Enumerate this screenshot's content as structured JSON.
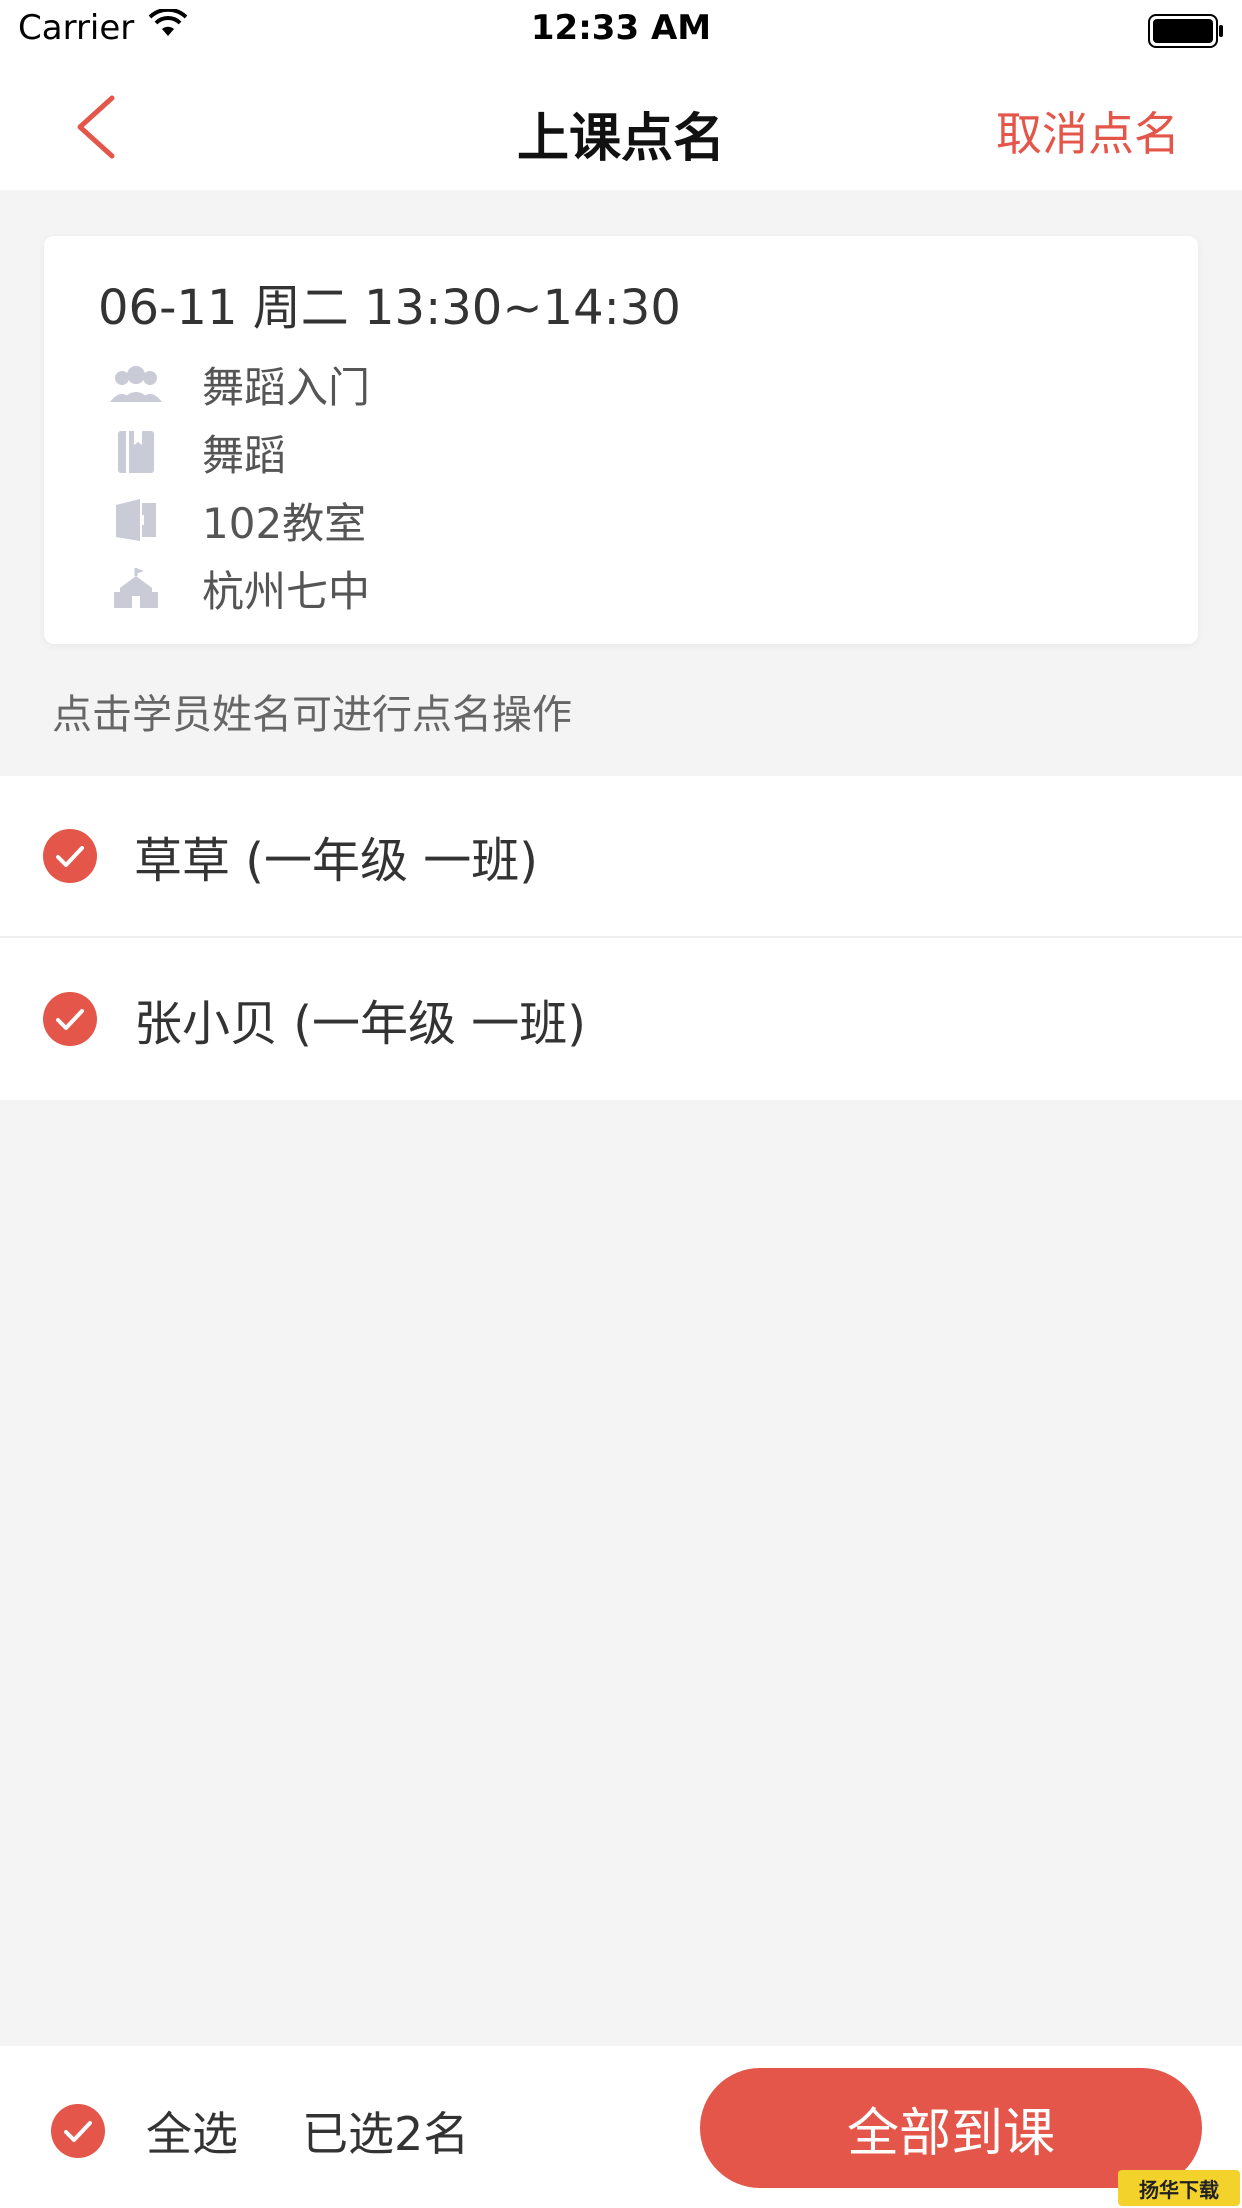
{
  "status_bar": {
    "carrier": "Carrier",
    "time": "12:33 AM"
  },
  "nav": {
    "title": "上课点名",
    "cancel_label": "取消点名"
  },
  "course": {
    "datetime": "06-11 周二 13:30~14:30",
    "class_name": "舞蹈入门",
    "subject": "舞蹈",
    "room": "102教室",
    "school": "杭州七中"
  },
  "hint": "点击学员姓名可进行点名操作",
  "students": [
    {
      "name": "草草 (一年级 一班)",
      "checked": true
    },
    {
      "name": "张小贝 (一年级 一班)",
      "checked": true
    }
  ],
  "bottom": {
    "select_all_label": "全选",
    "selected_count": "已选2名",
    "confirm_label": "全部到课"
  },
  "watermark": "扬华下载",
  "colors": {
    "accent": "#e4564a",
    "icon_gray": "#c9cbd6",
    "background": "#f4f4f4"
  }
}
